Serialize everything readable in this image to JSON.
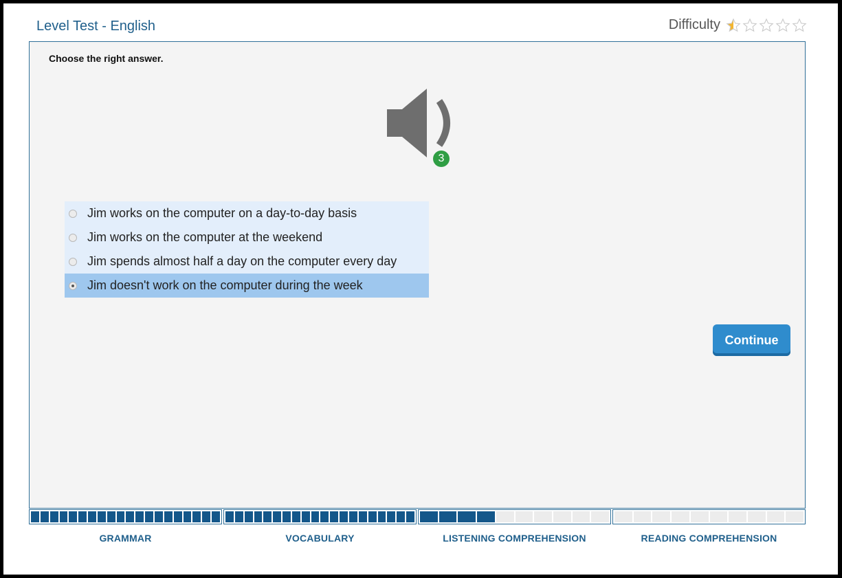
{
  "header": {
    "title": "Level Test - English",
    "difficulty_label": "Difficulty",
    "difficulty_rating": 0.5,
    "difficulty_max": 5
  },
  "question": {
    "instruction": "Choose the right answer.",
    "plays_remaining": "3",
    "options": [
      {
        "label": "Jim works on the computer on a day-to-day basis",
        "selected": false
      },
      {
        "label": "Jim works on the computer at the weekend",
        "selected": false
      },
      {
        "label": "Jim spends almost half a day on the computer every day",
        "selected": false
      },
      {
        "label": "Jim doesn't work on the computer during the week",
        "selected": true
      }
    ]
  },
  "actions": {
    "continue_label": "Continue"
  },
  "progress": {
    "sections": [
      {
        "label": "GRAMMAR",
        "filled": 20,
        "total": 20
      },
      {
        "label": "VOCABULARY",
        "filled": 20,
        "total": 20
      },
      {
        "label": "LISTENING COMPREHENSION",
        "filled": 4,
        "total": 10
      },
      {
        "label": "READING COMPREHENSION",
        "filled": 0,
        "total": 10
      }
    ]
  },
  "colors": {
    "accent": "#1f5f8b",
    "button": "#2f8ccd",
    "progress_fill": "#14578a",
    "badge": "#2f9e44",
    "selected_option": "#9ec7ee",
    "option_bg": "#e3eefb",
    "star": "#f2b530"
  }
}
